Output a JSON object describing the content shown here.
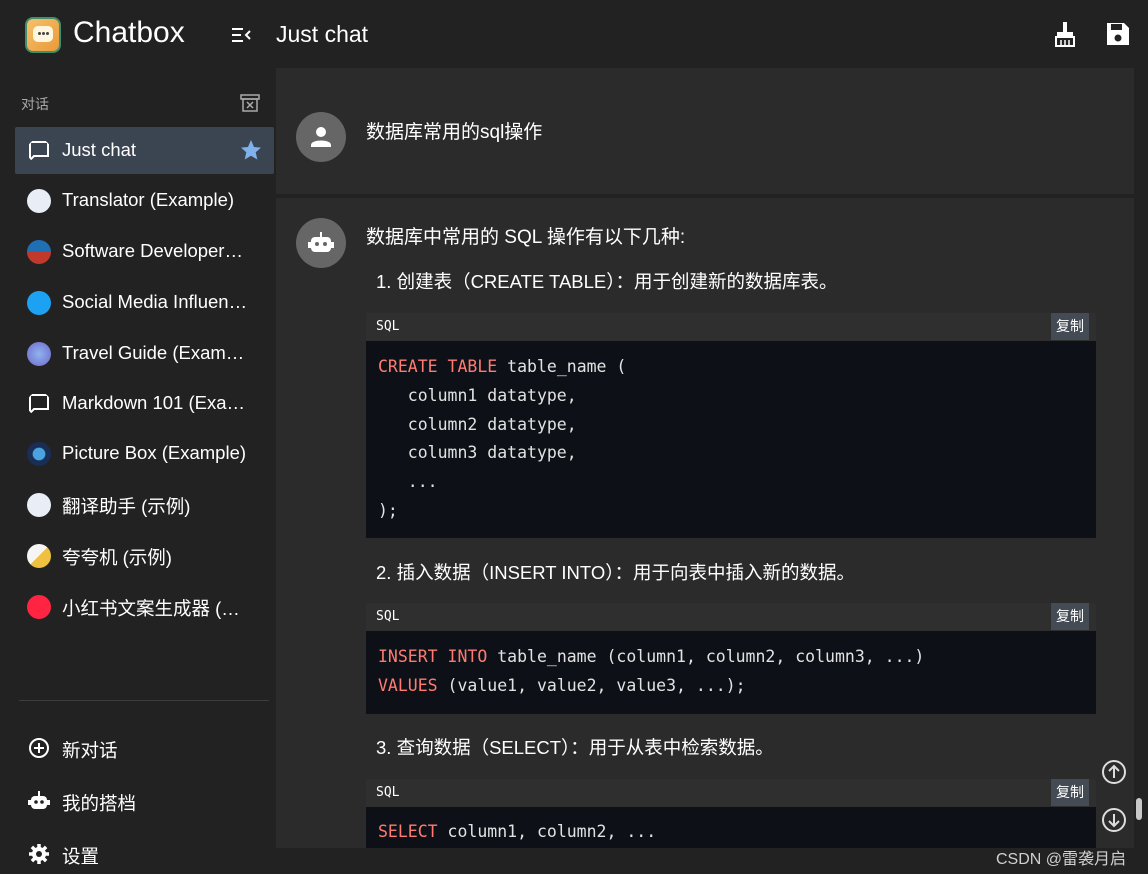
{
  "header": {
    "app_title": "Chatbox",
    "chat_title": "Just chat",
    "icons": [
      "collapse-sidebar-icon",
      "broom-icon",
      "save-icon"
    ]
  },
  "sidebar": {
    "section_label": "对话",
    "conversations": [
      {
        "label": "Just chat",
        "icon": "chat-bubble-icon",
        "active": true,
        "starred": true
      },
      {
        "label": "Translator (Example)",
        "icon": "translate-icon"
      },
      {
        "label": "Software Developer…",
        "icon": "developer-avatar-icon"
      },
      {
        "label": "Social Media Influen…",
        "icon": "twitter-icon"
      },
      {
        "label": "Travel Guide (Exam…",
        "icon": "globe-icon"
      },
      {
        "label": "Markdown 101 (Exa…",
        "icon": "chat-bubble-icon"
      },
      {
        "label": "Picture Box (Example)",
        "icon": "picture-icon"
      },
      {
        "label": "翻译助手 (示例)",
        "icon": "translate-icon"
      },
      {
        "label": "夸夸机 (示例)",
        "icon": "cheer-avatar-icon"
      },
      {
        "label": "小红书文案生成器 (…",
        "icon": "xiaohongshu-icon"
      }
    ],
    "footer": [
      {
        "label": "新对话",
        "icon": "add-circle-icon"
      },
      {
        "label": "我的搭档",
        "icon": "robot-icon"
      },
      {
        "label": "设置",
        "icon": "gear-icon"
      }
    ]
  },
  "messages": {
    "user_text": "数据库常用的sql操作",
    "assistant_intro": "数据库中常用的 SQL 操作有以下几种:",
    "items": [
      "1. 创建表（CREATE TABLE）：用于创建新的数据库表。",
      "2. 插入数据（INSERT INTO）：用于向表中插入新的数据。",
      "3. 查询数据（SELECT）：用于从表中检索数据。"
    ],
    "code_lang": "SQL",
    "copy_label": "复制",
    "code1": {
      "kw1": "CREATE TABLE",
      "rest1": " table_name (",
      "l2": "   column1 datatype,",
      "l3": "   column2 datatype,",
      "l4": "   column3 datatype,",
      "l5": "   ...",
      "l6": ");"
    },
    "code2": {
      "kw1": "INSERT INTO",
      "rest1": " table_name (column1, column2, column3, ...)",
      "kw2": "VALUES",
      "rest2": " (value1, value2, value3, ...);"
    },
    "code3": {
      "kw1": "SELECT",
      "rest1": " column1, column2, ..."
    }
  },
  "watermark": "CSDN @雷袭月启",
  "colors": {
    "active_item": "#3b4552",
    "keyword": "#ff7b72",
    "star": "#7fb2ec"
  }
}
